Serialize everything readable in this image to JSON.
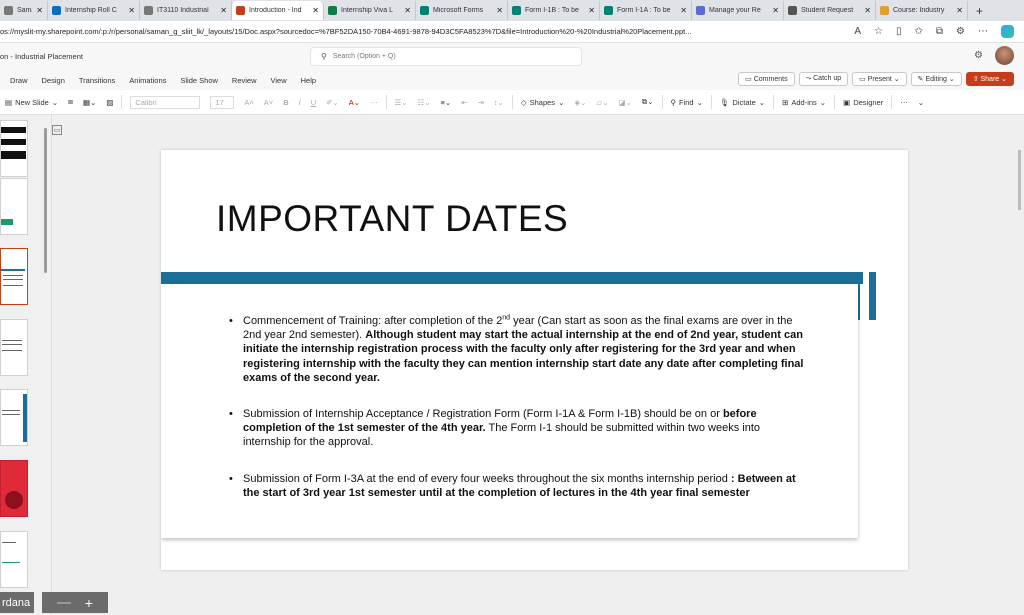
{
  "browser": {
    "tabs": [
      {
        "label": "Saman Gu",
        "color": "#777777",
        "active": false
      },
      {
        "label": "Internship Roll C",
        "color": "#0f6cbd",
        "active": false
      },
      {
        "label": "IT3110 Industrial",
        "color": "#777777",
        "active": false
      },
      {
        "label": "Introduction - Ind",
        "color": "#c43e1c",
        "active": true
      },
      {
        "label": "Internship Viva L",
        "color": "#107c41",
        "active": false
      },
      {
        "label": "Microsoft Forms",
        "color": "#008272",
        "active": false
      },
      {
        "label": "Form I-1B : To be",
        "color": "#008272",
        "active": false
      },
      {
        "label": "Form I-1A : To be",
        "color": "#008272",
        "active": false
      },
      {
        "label": "Manage your Re",
        "color": "#5b6bd1",
        "active": false
      },
      {
        "label": "Student Request",
        "color": "#555555",
        "active": false
      },
      {
        "label": "Course: Industry",
        "color": "#e0a030",
        "active": false
      }
    ],
    "new_tab_label": "+",
    "url": "os://myslit-my.sharepoint.com/:p:/r/personal/saman_g_sliit_lk/_layouts/15/Doc.aspx?sourcedoc=%7BF52DA150-70B4-4691-9878-94D3C5FA8523%7D&file=Introduction%20-%20Industrial%20Placement.ppt..."
  },
  "app": {
    "doc_title": "on - Industrial Placement",
    "search_placeholder": "Search (Option + Q)",
    "menu": [
      "Draw",
      "Design",
      "Transitions",
      "Animations",
      "Slide Show",
      "Review",
      "View",
      "Help"
    ],
    "actions": {
      "comments": "Comments",
      "catchup": "Catch up",
      "present": "Present",
      "editing": "Editing",
      "share": "Share"
    },
    "ribbon": {
      "new_slide": "New Slide",
      "font": "Calibri",
      "size": "17",
      "shapes": "Shapes",
      "find": "Find",
      "dictate": "Dictate",
      "addins": "Add-ins",
      "designer": "Designer"
    }
  },
  "slide": {
    "title": "IMPORTANT DATES",
    "bullet1": {
      "p1": "Commencement of Training: after completion of the 2",
      "sup": "nd",
      "p2": " year (Can start as soon as the final exams are over in the 2nd year 2nd semester). ",
      "bold": "Although student may start the actual internship at the end of 2nd year, student can initiate the internship registration process with the faculty only after registering for the 3rd year and when registering internship with the faculty they can mention internship start date any date after completing final exams of the second year."
    },
    "bullet2": {
      "p1": "Submission of Internship Acceptance / Registration Form (Form I-1A & Form I-1B) should be on or ",
      "bold": "before completion of the 1st semester of the 4th year.",
      "p2": " The Form I-1 should be submitted within two weeks into internship for the approval."
    },
    "bullet3": {
      "p1": "Submission of Form I-3A at the end of every four weeks throughout the six months internship period ",
      "bold": ": Between at the start of 3rd year 1st semester until at the completion of lectures in the 4th year final semester"
    }
  },
  "footer": {
    "name_fragment": "rdana",
    "add_label": "+"
  },
  "colors": {
    "accent_blue": "#1b6f97",
    "share_red": "#c43e1c",
    "selected_thumb": "#c43e1c"
  }
}
